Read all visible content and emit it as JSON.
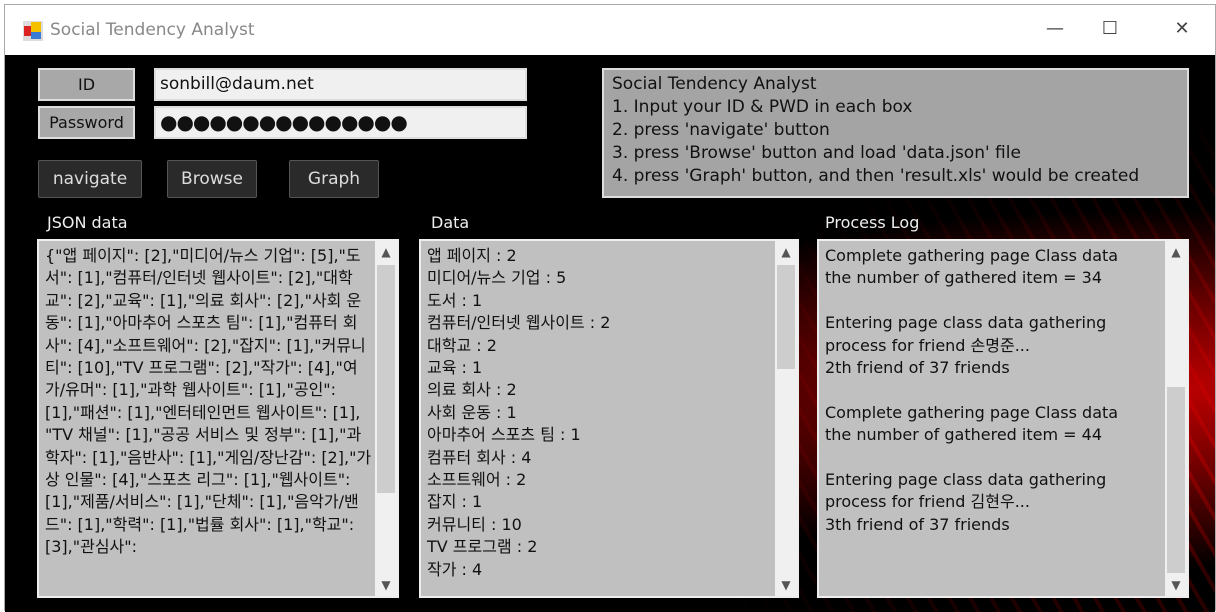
{
  "window": {
    "title": "Social Tendency Analyst",
    "minimize": "—",
    "maximize": "☐",
    "close": "✕"
  },
  "login": {
    "id_label": "ID",
    "id_value": "sonbill@daum.net",
    "password_label": "Password",
    "password_value": "●●●●●●●●●●●●●●●"
  },
  "buttons": {
    "navigate": "navigate",
    "browse": "Browse",
    "graph": "Graph"
  },
  "instructions": [
    "Social Tendency Analyst",
    "1. Input your ID & PWD in each box",
    "2. press 'navigate' button",
    "3. press 'Browse' button and load 'data.json' file",
    "4. press 'Graph' button, and then 'result.xls' would be created"
  ],
  "sections": {
    "json": "JSON data",
    "data": "Data",
    "log": "Process Log"
  },
  "json_text": "{\"앱 페이지\": [2],\"미디어/뉴스 기업\": [5],\"도서\": [1],\"컴퓨터/인터넷 웹사이트\": [2],\"대학교\": [2],\"교육\": [1],\"의료 회사\": [2],\"사회 운동\": [1],\"아마추어 스포츠 팀\": [1],\"컴퓨터 회사\": [4],\"소프트웨어\": [2],\"잡지\": [1],\"커뮤니티\": [10],\"TV 프로그램\": [2],\"작가\": [4],\"여가/유머\": [1],\"과학 웹사이트\": [1],\"공인\": [1],\"패션\": [1],\"엔터테인먼트 웹사이트\": [1],\n\"TV 채널\": [1],\"공공 서비스 및 정부\": [1],\"과학자\": [1],\"음반사\": [1],\"게임/장난감\": [2],\"가상 인물\": [4],\"스포츠 리그\": [1],\"웹사이트\": [1],\"제품/서비스\": [1],\"단체\": [1],\"음악가/밴드\": [1],\"학력\": [1],\"법률 회사\": [1],\"학교\": [3],\"관심사\":",
  "data_lines": [
    "앱 페이지 : 2",
    "미디어/뉴스 기업 : 5",
    "도서 : 1",
    "컴퓨터/인터넷 웹사이트 : 2",
    "대학교 : 2",
    "교육 : 1",
    "의료 회사 : 2",
    "사회 운동 : 1",
    "아마추어 스포츠 팀 : 1",
    "컴퓨터 회사 : 4",
    "소프트웨어 : 2",
    "잡지 : 1",
    "커뮤니티 : 10",
    "TV 프로그램 : 2",
    "작가 : 4"
  ],
  "log_lines": [
    "Complete gathering page Class data",
    "the number of gathered item = 34",
    "",
    "Entering page class data gathering",
    "process for friend 손명준...",
    "2th friend of 37 friends",
    "",
    "Complete gathering page Class data",
    "the number of gathered item = 44",
    "",
    "Entering page class data gathering",
    "process for friend 김현우...",
    "3th friend of 37 friends"
  ],
  "icons": {
    "scroll_up": "▲",
    "scroll_down": "▼"
  }
}
